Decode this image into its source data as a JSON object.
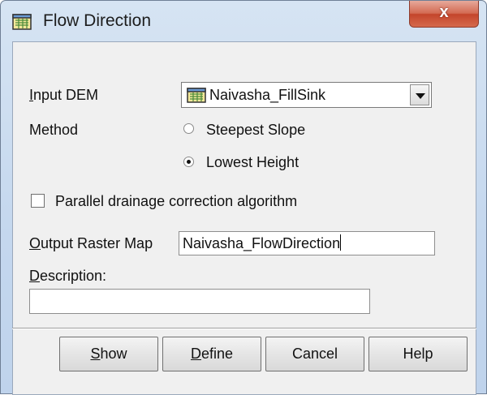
{
  "window": {
    "title": "Flow Direction",
    "close_label": "x",
    "icon": "map-grid-icon"
  },
  "form": {
    "input_dem": {
      "label_first": "I",
      "label_rest": "nput DEM",
      "value": "Naivasha_FillSink",
      "icon": "raster-map-icon"
    },
    "method": {
      "label": "Method",
      "options": [
        {
          "label": "Steepest Slope",
          "checked": false
        },
        {
          "label": "Lowest Height",
          "checked": true
        }
      ]
    },
    "parallel_correction": {
      "label": "Parallel drainage correction algorithm",
      "checked": false
    },
    "output_raster": {
      "label_first": "O",
      "label_rest": "utput Raster Map",
      "value": "Naivasha_FlowDirection"
    },
    "description": {
      "label_first": "D",
      "label_rest": "escription:",
      "value": ""
    }
  },
  "buttons": {
    "show": {
      "first": "S",
      "rest": "how"
    },
    "define": {
      "first": "D",
      "rest": "efine"
    },
    "cancel": "Cancel",
    "help": "Help"
  }
}
